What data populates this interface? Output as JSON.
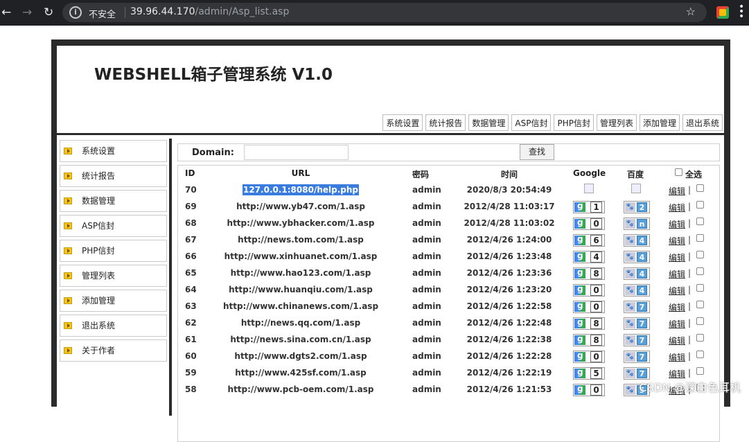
{
  "browser": {
    "insecure_label": "不安全",
    "url_host": "39.96.44.170",
    "url_path": "/admin/Asp_list.asp"
  },
  "app": {
    "title": "WEBSHELL箱子管理系统 V1.0",
    "top_nav": [
      "系统设置",
      "统计报告",
      "数据管理",
      "ASP信封",
      "PHP信封",
      "管理列表",
      "添加管理",
      "退出系统"
    ],
    "sidebar": [
      "系统设置",
      "统计报告",
      "数据管理",
      "ASP信封",
      "PHP信封",
      "管理列表",
      "添加管理",
      "退出系统",
      "关于作者"
    ]
  },
  "search": {
    "label": "Domain:",
    "value": "",
    "button": "查找"
  },
  "table": {
    "headers": {
      "id": "ID",
      "url": "URL",
      "pwd": "密码",
      "time": "时间",
      "google": "Google",
      "baidu": "百度",
      "select_all": "全选"
    },
    "edit_label": "编辑",
    "separator": "|",
    "rows": [
      {
        "id": "70",
        "url": "127.0.0.1:8080/help.php",
        "pwd": "admin",
        "time": "2020/8/3 20:54:49",
        "google": "",
        "baidu": "",
        "highlight": true
      },
      {
        "id": "69",
        "url": "http://www.yb47.com/1.asp",
        "pwd": "admin",
        "time": "2012/4/28 11:03:17",
        "google": "1",
        "baidu": "2"
      },
      {
        "id": "68",
        "url": "http://www.ybhacker.com/1.asp",
        "pwd": "admin",
        "time": "2012/4/28 11:03:02",
        "google": "0",
        "baidu": "n"
      },
      {
        "id": "67",
        "url": "http://news.tom.com/1.asp",
        "pwd": "admin",
        "time": "2012/4/26 1:24:00",
        "google": "6",
        "baidu": "4"
      },
      {
        "id": "66",
        "url": "http://www.xinhuanet.com/1.asp",
        "pwd": "admin",
        "time": "2012/4/26 1:23:48",
        "google": "4",
        "baidu": "4"
      },
      {
        "id": "65",
        "url": "http://www.hao123.com/1.asp",
        "pwd": "admin",
        "time": "2012/4/26 1:23:36",
        "google": "8",
        "baidu": "4"
      },
      {
        "id": "64",
        "url": "http://www.huanqiu.com/1.asp",
        "pwd": "admin",
        "time": "2012/4/26 1:23:20",
        "google": "0",
        "baidu": "4"
      },
      {
        "id": "63",
        "url": "http://www.chinanews.com/1.asp",
        "pwd": "admin",
        "time": "2012/4/26 1:22:58",
        "google": "0",
        "baidu": "7"
      },
      {
        "id": "62",
        "url": "http://news.qq.com/1.asp",
        "pwd": "admin",
        "time": "2012/4/26 1:22:48",
        "google": "8",
        "baidu": "7"
      },
      {
        "id": "61",
        "url": "http://news.sina.com.cn/1.asp",
        "pwd": "admin",
        "time": "2012/4/26 1:22:38",
        "google": "8",
        "baidu": "7"
      },
      {
        "id": "60",
        "url": "http://www.dgts2.com/1.asp",
        "pwd": "admin",
        "time": "2012/4/26 1:22:28",
        "google": "0",
        "baidu": "7"
      },
      {
        "id": "59",
        "url": "http://www.425sf.com/1.asp",
        "pwd": "admin",
        "time": "2012/4/26 1:22:19",
        "google": "5",
        "baidu": "7"
      },
      {
        "id": "58",
        "url": "http://www.pcb-oem.com/1.asp",
        "pwd": "admin",
        "time": "2012/4/26 1:21:53",
        "google": "0",
        "baidu": "5"
      }
    ]
  },
  "watermark": "CSDN @深白色耳机",
  "colors": {
    "frame": "#2b2b2b",
    "highlight": "#3a7be0"
  }
}
